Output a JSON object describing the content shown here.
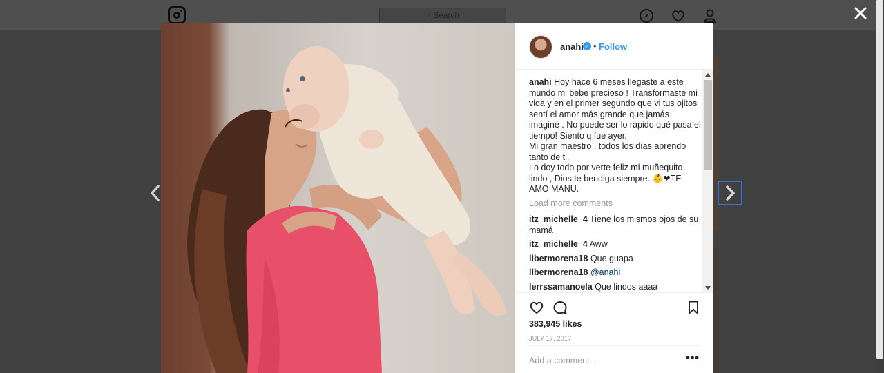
{
  "background": {
    "search_placeholder": "Search",
    "nav_icons": [
      "compass-icon",
      "heart-icon",
      "profile-icon"
    ]
  },
  "post": {
    "username": "anahi",
    "verified": true,
    "follow_label": "Follow",
    "separator": "•",
    "caption_user": "anahi",
    "caption_text": " Hoy hace 6 meses llegaste a este mundo mi bebe precioso ! Transformaste mi vida y en el primer segundo que vi tus ojitos sentí el amor más grande que jamás imaginé . No puede ser lo rápido qué pasa el tiempo! Siento q fue ayer.\nMi gran maestro , todos los días aprendo tanto de ti.\nLo doy todo por verte feliz mi muñequito lindo , Dios te bendiga siempre. 👶❤TE AMO MANU.",
    "load_more": "Load more comments",
    "comments": [
      {
        "user": "itz_michelle_4",
        "text": "Tiene los mismos ojos de su mamá"
      },
      {
        "user": "itz_michelle_4",
        "text": "Aww"
      },
      {
        "user": "libermorena18",
        "text": "Que guapa"
      },
      {
        "user": "libermorena18",
        "text": "@anahi"
      },
      {
        "user": "lerrssamanoela",
        "text": "Que lindos aaaa"
      }
    ],
    "likes": "383,945 likes",
    "date": "JULY 17, 2017",
    "add_comment_placeholder": "Add a comment...",
    "more_options": "•••"
  },
  "colors": {
    "accent": "#3897f0",
    "text": "#262626",
    "muted": "#999999",
    "dress": "#e8506a"
  }
}
